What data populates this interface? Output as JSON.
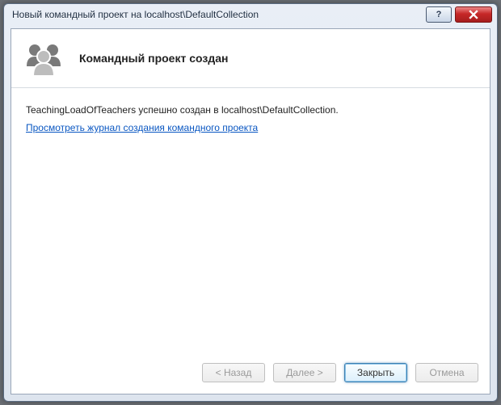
{
  "window": {
    "title": "Новый командный проект на localhost\\DefaultCollection"
  },
  "header": {
    "heading": "Командный проект создан"
  },
  "body": {
    "status_text": "TeachingLoadOfTeachers успешно создан в localhost\\DefaultCollection.",
    "log_link": "Просмотреть журнал создания командного проекта"
  },
  "footer": {
    "back_label": "< Назад",
    "next_label": "Далее >",
    "close_label": "Закрыть",
    "cancel_label": "Отмена"
  }
}
